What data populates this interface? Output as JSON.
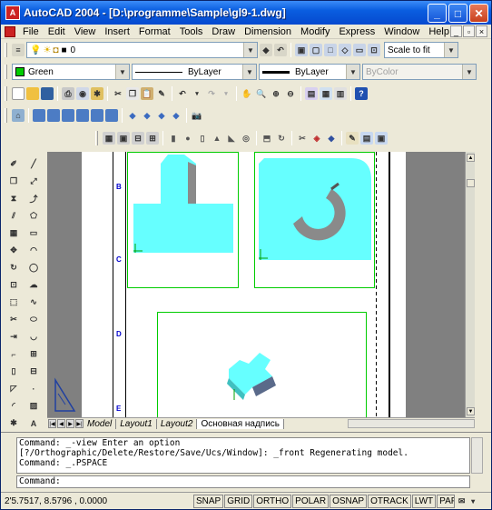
{
  "window": {
    "title": "AutoCAD 2004 - [D:\\programme\\Sample\\gl9-1.dwg]"
  },
  "menu": [
    "File",
    "Edit",
    "View",
    "Insert",
    "Format",
    "Tools",
    "Draw",
    "Dimension",
    "Modify",
    "Express",
    "Window",
    "Help"
  ],
  "layer_combo": {
    "value": "0"
  },
  "view_combo": {
    "value": "Scale to fit"
  },
  "props": {
    "color": "Green",
    "linetype": "ByLayer",
    "lineweight": "ByLayer",
    "plotstyle": "ByColor"
  },
  "zones": [
    "B",
    "C",
    "D",
    "E"
  ],
  "tabs": [
    "Model",
    "Layout1",
    "Layout2",
    "Основная надпись"
  ],
  "command": {
    "history": [
      "Command: _-view Enter an option",
      "[?/Orthographic/Delete/Restore/Save/Ucs/Window]: _front Regenerating model.",
      "Command: _.PSPACE"
    ],
    "prompt": "Command:"
  },
  "status": {
    "coords": "2'5.7517, 8.5796 , 0.0000",
    "toggles": [
      "SNAP",
      "GRID",
      "ORTHO",
      "POLAR",
      "OSNAP",
      "OTRACK",
      "LWT",
      "PAPER"
    ]
  },
  "colors": {
    "model_cyan": "#66ffff",
    "viewport_border": "#00cc00",
    "titlebar": "#0a5ee0"
  }
}
